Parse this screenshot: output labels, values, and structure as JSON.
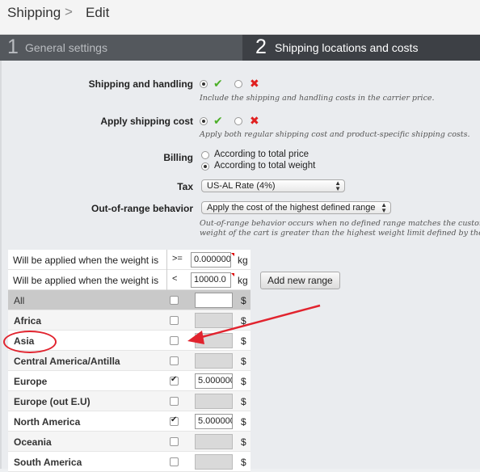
{
  "breadcrumb": {
    "parent": "Shipping",
    "separator": ">",
    "current": "Edit"
  },
  "steps": [
    {
      "num": "1",
      "label": "General settings"
    },
    {
      "num": "2",
      "label": "Shipping locations and costs"
    }
  ],
  "settings": {
    "shipping_handling": {
      "label": "Shipping and handling",
      "hint": "Include the shipping and handling costs in the carrier price."
    },
    "apply_cost": {
      "label": "Apply shipping cost",
      "hint": "Apply both regular shipping cost and product-specific shipping costs."
    },
    "billing": {
      "label": "Billing",
      "options": [
        "According to total price",
        "According to total weight"
      ],
      "selected": "According to total weight"
    },
    "tax": {
      "label": "Tax",
      "value": "US-AL Rate (4%)"
    },
    "out_of_range": {
      "label": "Out-of-range behavior",
      "value": "Apply the cost of the highest defined range",
      "hint_line1": "Out-of-range behavior occurs when no defined range matches the customer's",
      "hint_line2": "weight of the cart is greater than the highest weight limit defined by the weig"
    }
  },
  "ranges": {
    "from": {
      "text": "Will be applied when the weight is",
      "op": ">=",
      "value": "0.000000",
      "unit": "kg"
    },
    "to": {
      "text": "Will be applied when the weight is",
      "op": "<",
      "value": "10000.0",
      "unit": "kg"
    },
    "add_button": "Add new range"
  },
  "zones": {
    "currency": "$",
    "rows": [
      {
        "name": "All",
        "checked": false,
        "price": ""
      },
      {
        "name": "Africa",
        "checked": false,
        "price": ""
      },
      {
        "name": "Asia",
        "checked": false,
        "price": ""
      },
      {
        "name": "Central America/Antilla",
        "checked": false,
        "price": ""
      },
      {
        "name": "Europe",
        "checked": true,
        "price": "5.000000"
      },
      {
        "name": "Europe (out E.U)",
        "checked": false,
        "price": ""
      },
      {
        "name": "North America",
        "checked": true,
        "price": "5.000000"
      },
      {
        "name": "Oceania",
        "checked": false,
        "price": ""
      },
      {
        "name": "South America",
        "checked": false,
        "price": ""
      }
    ]
  },
  "colors": {
    "annotation": "#e1232e",
    "yes": "#4caf28",
    "no": "#e02020"
  }
}
